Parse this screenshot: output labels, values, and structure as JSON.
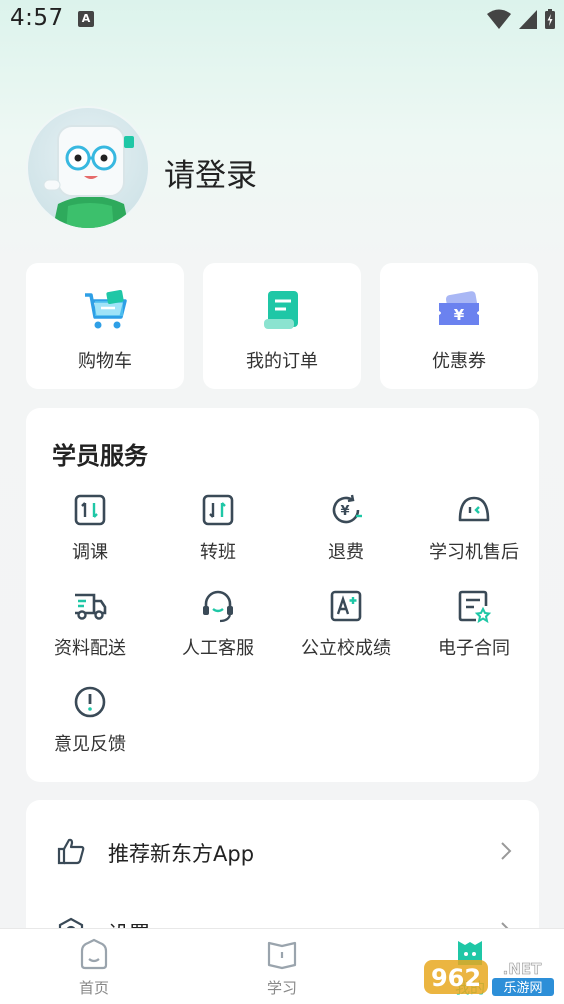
{
  "status_bar": {
    "time": "4:57",
    "notification_glyph": "A"
  },
  "profile": {
    "login_text": "请登录"
  },
  "quick_actions": [
    {
      "label": "购物车",
      "icon": "shopping-cart-icon"
    },
    {
      "label": "我的订单",
      "icon": "order-document-icon"
    },
    {
      "label": "优惠券",
      "icon": "coupon-ticket-icon"
    }
  ],
  "services": {
    "title": "学员服务",
    "items": [
      {
        "label": "调课",
        "icon": "adjust-class-icon"
      },
      {
        "label": "转班",
        "icon": "transfer-class-icon"
      },
      {
        "label": "退费",
        "icon": "refund-icon"
      },
      {
        "label": "学习机售后",
        "icon": "device-aftersales-icon"
      },
      {
        "label": "资料配送",
        "icon": "delivery-truck-icon"
      },
      {
        "label": "人工客服",
        "icon": "headset-icon"
      },
      {
        "label": "公立校成绩",
        "icon": "grade-a-plus-icon"
      },
      {
        "label": "电子合同",
        "icon": "e-contract-icon"
      },
      {
        "label": "意见反馈",
        "icon": "feedback-exclamation-icon"
      }
    ]
  },
  "menu": {
    "items": [
      {
        "label": "推荐新东方App",
        "icon": "thumbs-up-icon"
      },
      {
        "label": "设置",
        "icon": "settings-icon"
      }
    ]
  },
  "bottom_nav": {
    "items": [
      {
        "label": "首页",
        "icon": "home-icon"
      },
      {
        "label": "学习",
        "icon": "study-book-icon"
      },
      {
        "label": "我的",
        "icon": "profile-icon",
        "active": true
      }
    ]
  },
  "watermark": {
    "brand_number": "962",
    "suffix": ".NET",
    "text": "乐游网"
  },
  "colors": {
    "accent": "#1fc7a6",
    "icon_stroke": "#3a4a57",
    "background": "#f3f4f5"
  }
}
